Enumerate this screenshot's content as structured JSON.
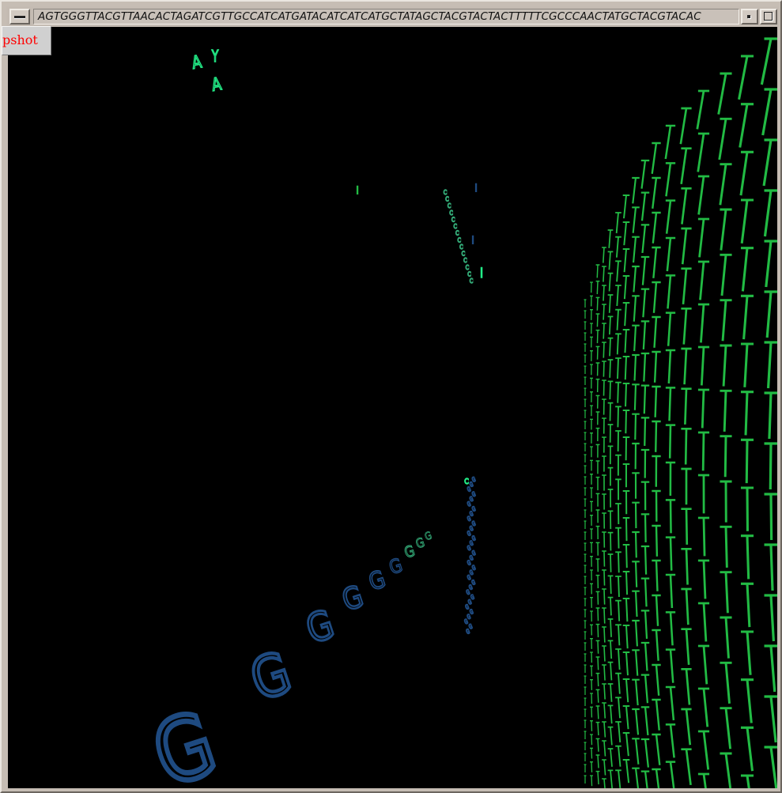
{
  "window": {
    "title": "AGTGGGTTACGTTAACACTAGATCGTTGCCATCATGATACATCATCATGCTATAGCTACGTACTACTTTTTCGCCCAACTATGCTACGTACAC",
    "menu_icon": "window-menu-icon",
    "minimize_icon": "minimize-icon",
    "maximize_icon": "maximize-icon"
  },
  "snapshot_button": {
    "label": "pshot",
    "color": "#ff0000"
  },
  "scene": {
    "background": "#000000",
    "colors": {
      "T": "#22bb44",
      "G": "#1e4a80",
      "A": "#22ee88",
      "C": "#33aa77"
    }
  }
}
